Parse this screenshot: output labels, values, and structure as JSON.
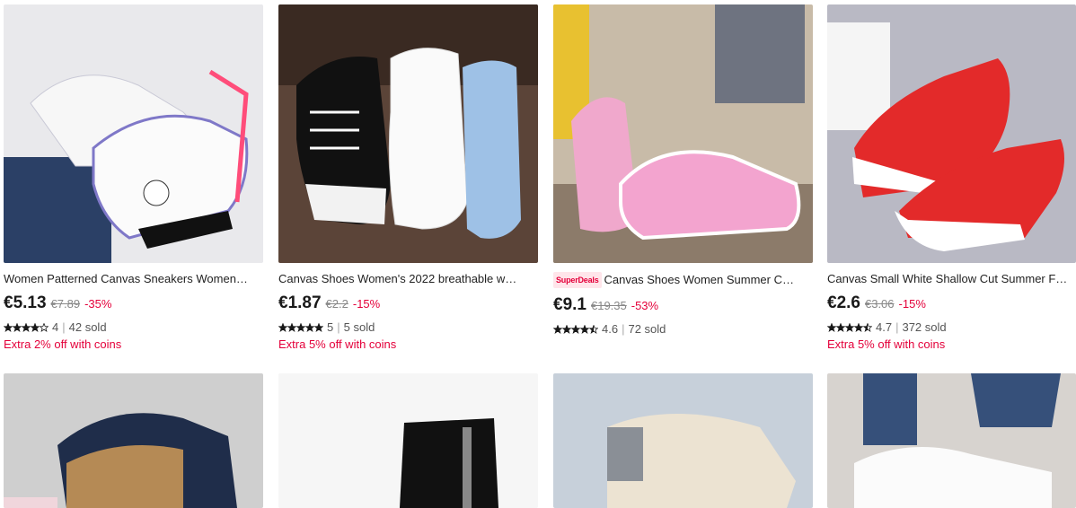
{
  "products": [
    {
      "title": "Women Patterned Canvas Sneakers Women…",
      "price": "€5.13",
      "old_price": "€7.89",
      "discount": "-35%",
      "rating": "4",
      "stars": 4,
      "sold": "42 sold",
      "promo": "Extra 2% off with coins",
      "badge": ""
    },
    {
      "title": "Canvas Shoes Women's 2022 breathable w…",
      "price": "€1.87",
      "old_price": "€2.2",
      "discount": "-15%",
      "rating": "5",
      "stars": 5,
      "sold": "5 sold",
      "promo": "Extra 5% off with coins",
      "badge": ""
    },
    {
      "title": "Canvas Shoes Women Summer C…",
      "price": "€9.1",
      "old_price": "€19.35",
      "discount": "-53%",
      "rating": "4.6",
      "stars": 4.5,
      "sold": "72 sold",
      "promo": "",
      "badge": "SuperDeals"
    },
    {
      "title": "Canvas Small White Shallow Cut Summer F…",
      "price": "€2.6",
      "old_price": "€3.06",
      "discount": "-15%",
      "rating": "4.7",
      "stars": 4.5,
      "sold": "372 sold",
      "promo": "Extra 5% off with coins",
      "badge": ""
    }
  ],
  "colors": {
    "accent": "#e4003a",
    "price": "#191919"
  },
  "icons": {
    "star": "star-icon"
  }
}
